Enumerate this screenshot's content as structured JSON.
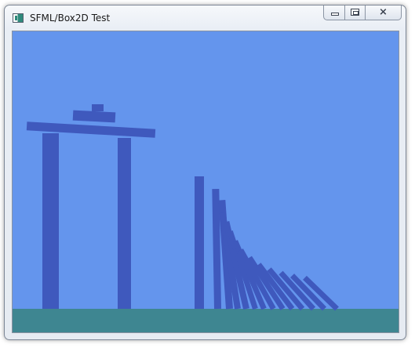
{
  "window": {
    "title": "SFML/Box2D Test",
    "icon": "app-window-icon",
    "buttons": {
      "minimize": "minimize-icon",
      "maximize": "maximize-icon",
      "close": "close-icon"
    }
  },
  "colors": {
    "sky": "#6495ed",
    "body": "#3f59bd",
    "ground": "#3e8691"
  },
  "scene": {
    "structure": [
      "left-pillar",
      "right-pillar",
      "tilted-plank",
      "middle-block",
      "top-block"
    ],
    "domino_count": 14
  }
}
